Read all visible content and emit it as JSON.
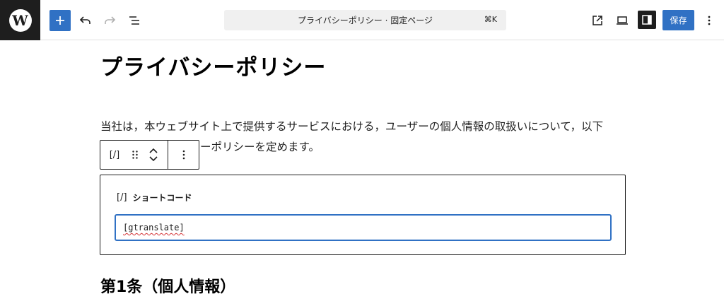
{
  "toolbar": {
    "logo_glyph": "W",
    "document_title": "プライバシーポリシー · 固定ページ",
    "command_shortcut": "⌘K",
    "save_label": "保存"
  },
  "content": {
    "title": "プライバシーポリシー",
    "paragraph_line1": "当社は，本ウェブサイト上で提供するサービスにおける，ユーザーの個人情報の取扱いについて，以下",
    "paragraph_line2": "ーポリシーを定めます。",
    "heading": "第1条（個人情報）"
  },
  "block_toolbar": {
    "shortcode_icon": "[/]"
  },
  "shortcode_block": {
    "icon": "[/]",
    "label": "ショートコード",
    "value": "[gtranslate]"
  },
  "colors": {
    "accent": "#3071c4",
    "dark": "#1e1e1e",
    "spellcheck": "#d63638"
  },
  "icons": [
    "wordpress-logo",
    "plus-icon",
    "undo-icon",
    "redo-icon",
    "list-view-icon",
    "external-link-icon",
    "desktop-preview-icon",
    "sidebar-icon",
    "more-vertical-icon",
    "drag-handle-icon",
    "chevron-up-icon",
    "chevron-down-icon"
  ]
}
